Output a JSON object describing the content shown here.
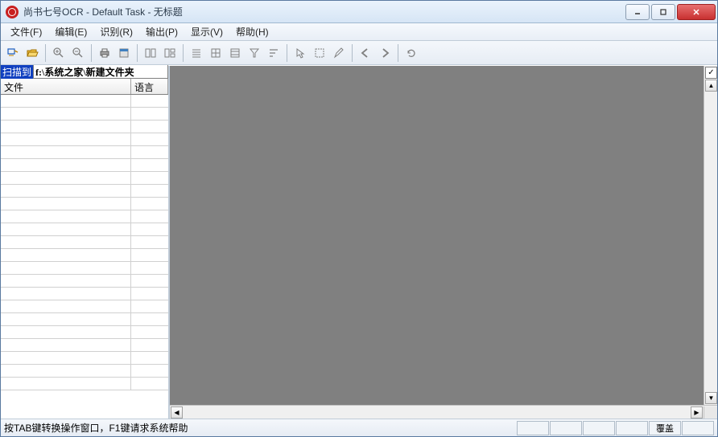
{
  "title": "尚书七号OCR - Default Task - 无标题",
  "menu": [
    "文件(F)",
    "编辑(E)",
    "识别(R)",
    "输出(P)",
    "显示(V)",
    "帮助(H)"
  ],
  "scan": {
    "label": "扫描到",
    "path": "f:\\系统之家\\新建文件夹"
  },
  "headers": {
    "file": "文件",
    "lang": "语言"
  },
  "status": {
    "text": "按TAB键转换操作窗口，F1键请求系统帮助",
    "overwrite": "覆盖"
  },
  "icons": {
    "scan": "scan-icon",
    "open": "open-icon",
    "zoomin": "zoom-in-icon",
    "zoomout": "zoom-out-icon",
    "print": "print-icon",
    "preview": "preview-icon",
    "layout1": "layout-icon",
    "layout2": "layout-icon",
    "list": "list-icon",
    "grid1": "grid-icon",
    "grid2": "grid-icon",
    "filter": "filter-icon",
    "sort": "sort-icon",
    "pointer": "pointer-icon",
    "select": "select-icon",
    "pen": "pen-icon",
    "back": "back-icon",
    "forward": "forward-icon",
    "refresh": "refresh-icon"
  }
}
